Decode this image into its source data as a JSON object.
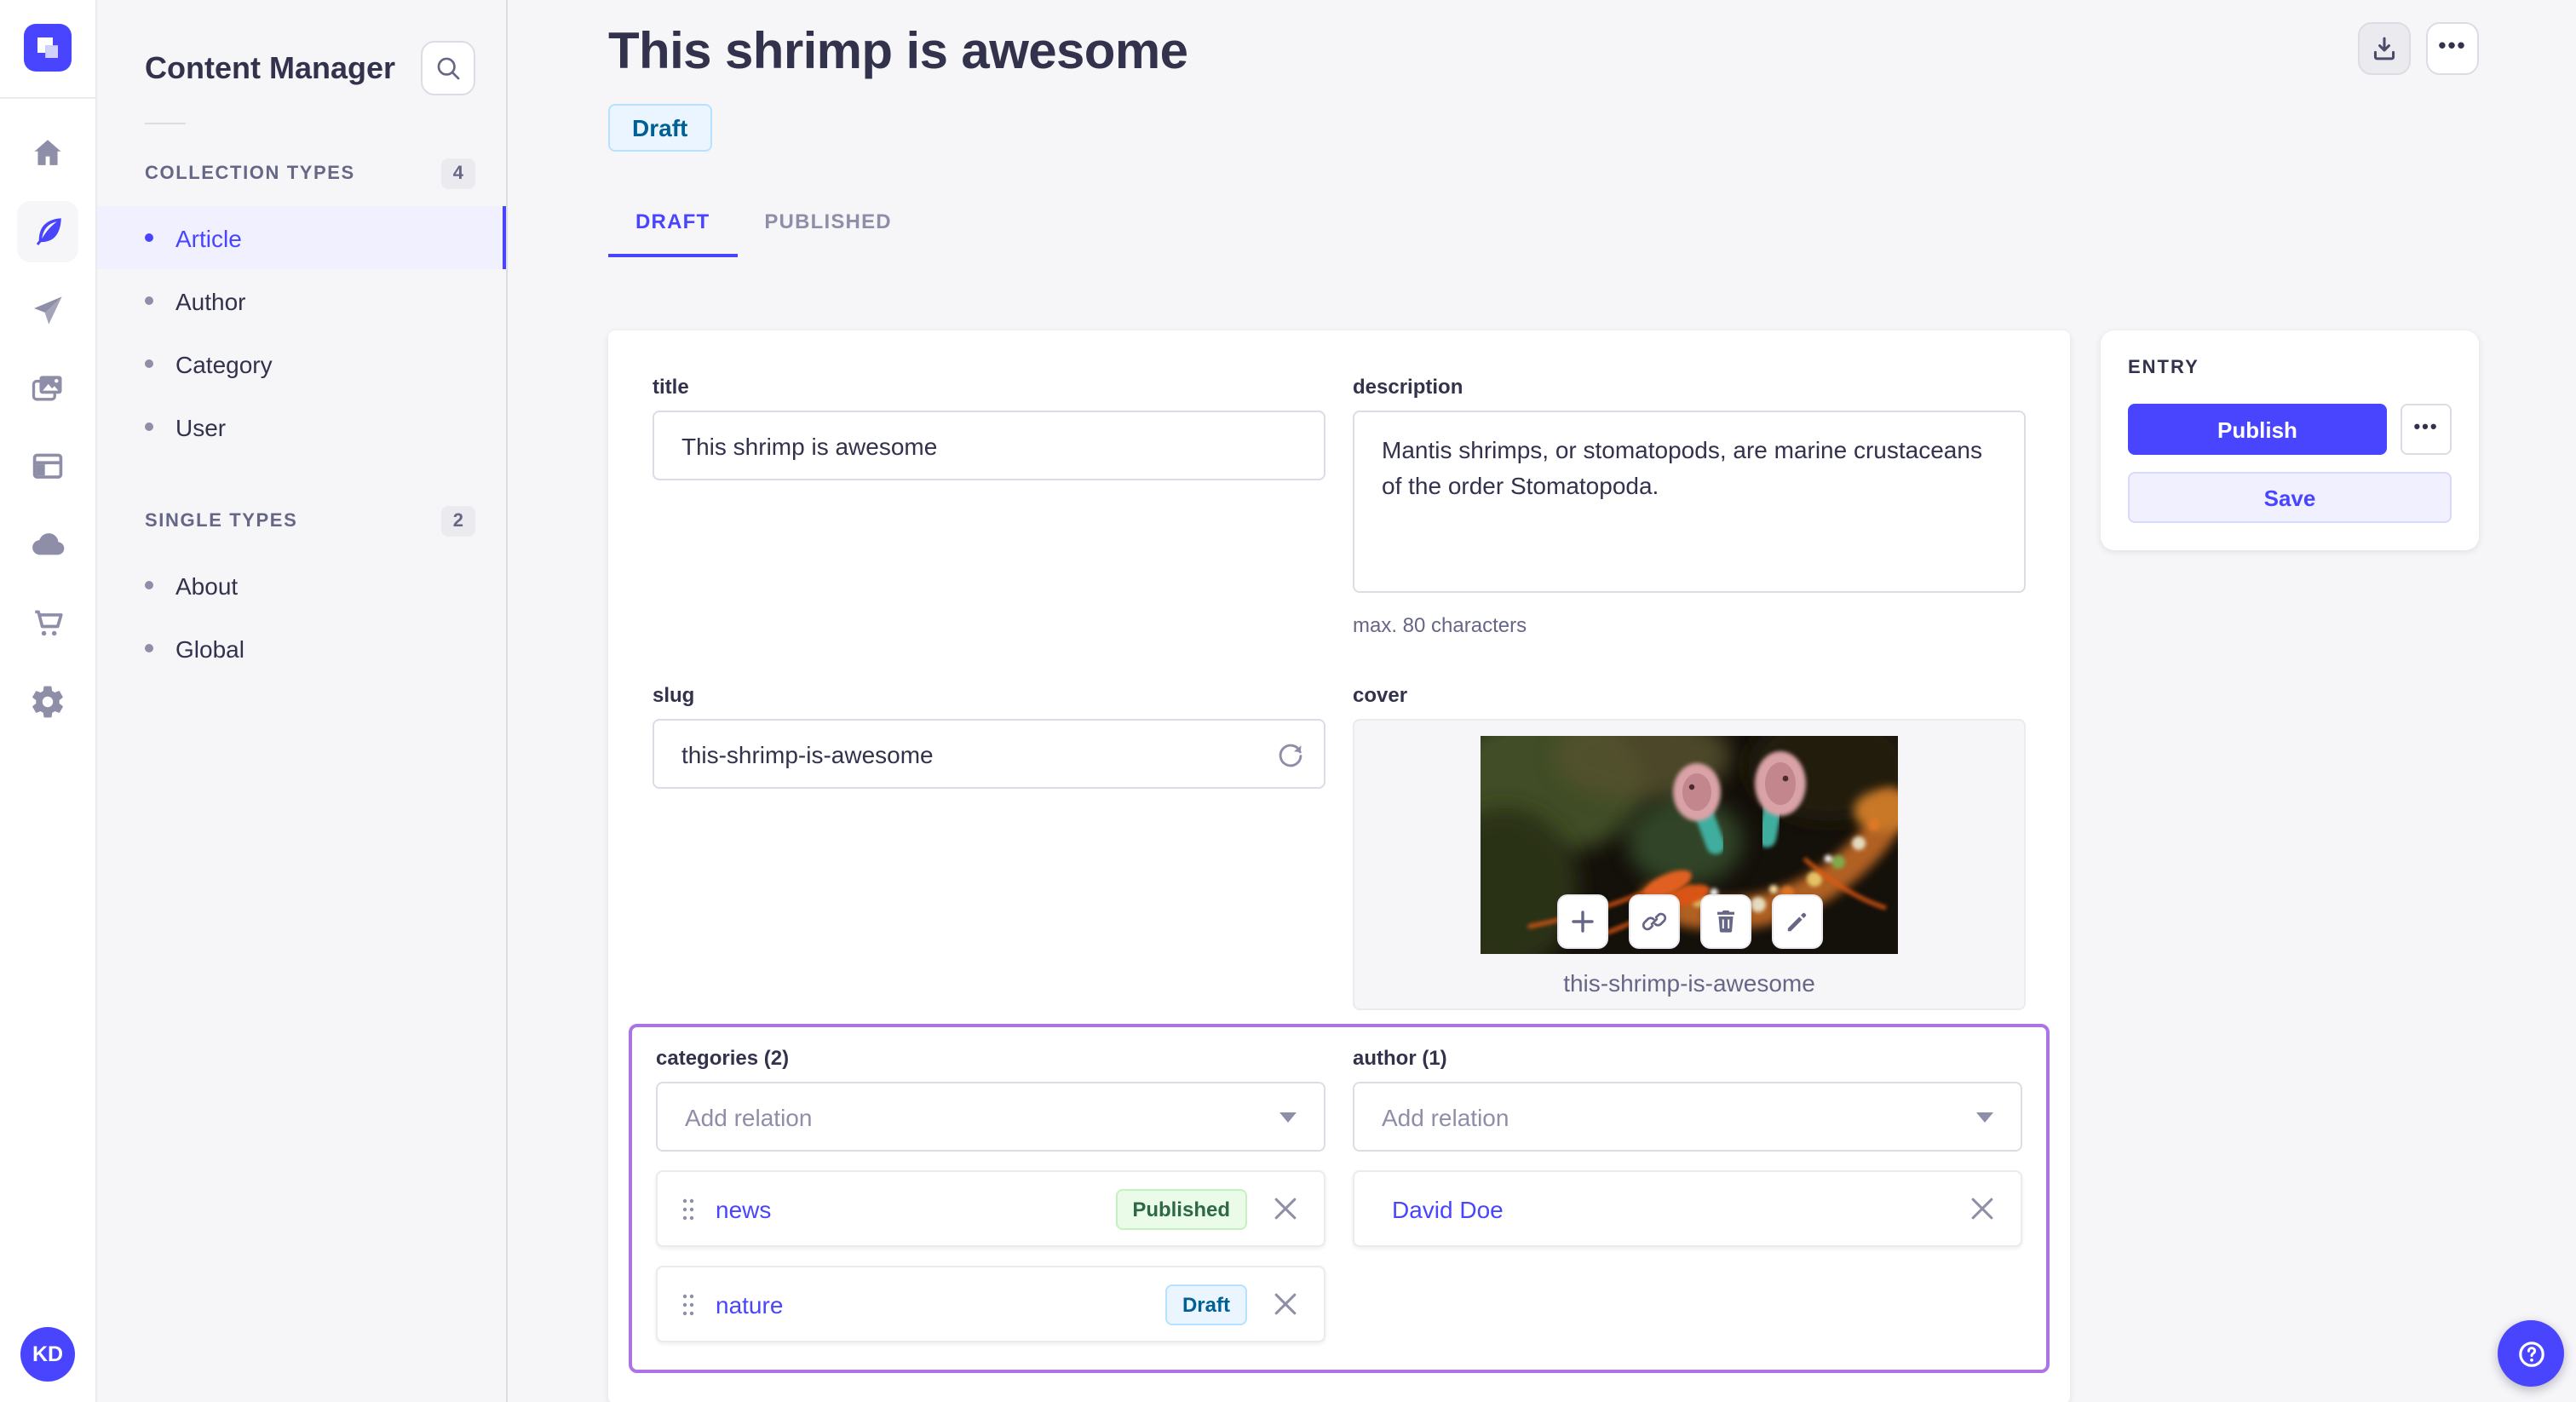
{
  "sidebar": {
    "title": "Content Manager",
    "sections": [
      {
        "label": "COLLECTION TYPES",
        "count": "4",
        "items": [
          {
            "label": "Article"
          },
          {
            "label": "Author"
          },
          {
            "label": "Category"
          },
          {
            "label": "User"
          }
        ]
      },
      {
        "label": "SINGLE TYPES",
        "count": "2",
        "items": [
          {
            "label": "About"
          },
          {
            "label": "Global"
          }
        ]
      }
    ]
  },
  "header": {
    "title": "This shrimp is awesome",
    "status": "Draft",
    "tabs": [
      {
        "label": "DRAFT"
      },
      {
        "label": "PUBLISHED"
      }
    ]
  },
  "topbar": {
    "more_icon": "•••"
  },
  "form": {
    "title": {
      "label": "title",
      "value": "This shrimp is awesome"
    },
    "description": {
      "label": "description",
      "value": "Mantis shrimps, or stomatopods, are marine crustaceans of the order Stomatopoda.",
      "helper": "max. 80 characters"
    },
    "slug": {
      "label": "slug",
      "value": "this-shrimp-is-awesome"
    },
    "cover": {
      "label": "cover",
      "caption": "this-shrimp-is-awesome"
    },
    "categories": {
      "label": "categories (2)",
      "placeholder": "Add relation",
      "items": [
        {
          "name": "news",
          "status": "Published"
        },
        {
          "name": "nature",
          "status": "Draft"
        }
      ]
    },
    "author": {
      "label": "author (1)",
      "placeholder": "Add relation",
      "items": [
        {
          "name": "David Doe"
        }
      ]
    }
  },
  "entry": {
    "title": "ENTRY",
    "publish_label": "Publish",
    "save_label": "Save",
    "more_icon": "•••"
  },
  "user": {
    "initials": "KD"
  },
  "colors": {
    "primary": "#4945ff",
    "highlight": "#ac73e6",
    "draft_bg": "#eaf5ff",
    "draft_text": "#006096",
    "published_bg": "#eafbe7",
    "published_text": "#2f6846",
    "page_bg": "#f6f6f9"
  }
}
